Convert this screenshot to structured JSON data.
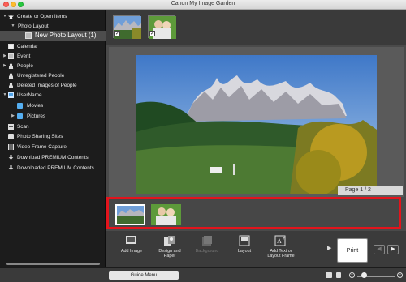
{
  "window": {
    "title": "Canon My Image Garden"
  },
  "sidebar": {
    "items": [
      {
        "label": "Create or Open Items",
        "icon": "star-icon"
      },
      {
        "label": "Photo Layout",
        "icon": ""
      },
      {
        "label": "New Photo Layout (1)",
        "icon": "layout-icon"
      },
      {
        "label": "Calendar",
        "icon": "calendar-icon"
      },
      {
        "label": "Event",
        "icon": "event-icon"
      },
      {
        "label": "People",
        "icon": "person-icon"
      },
      {
        "label": "Unregistered People",
        "icon": "person-icon"
      },
      {
        "label": "Deleted Images of People",
        "icon": "person-icon"
      },
      {
        "label": "UserName",
        "icon": "computer-icon"
      },
      {
        "label": "Movies",
        "icon": "folder-icon"
      },
      {
        "label": "Pictures",
        "icon": "folder-icon"
      },
      {
        "label": "Scan",
        "icon": "scan-icon"
      },
      {
        "label": "Photo Sharing Sites",
        "icon": "share-icon"
      },
      {
        "label": "Video Frame Capture",
        "icon": "film-icon"
      },
      {
        "label": "Download PREMIUM Contents",
        "icon": "download-icon"
      },
      {
        "label": "Downloaded PREMIUM Contents",
        "icon": "download-icon"
      }
    ]
  },
  "main": {
    "page_indicator": "Page 1 / 2",
    "toolbar": {
      "add_image": "Add Image",
      "design_and_paper": "Design and Paper",
      "background": "Background",
      "layout": "Layout",
      "add_text": "Add Text or Layout Frame",
      "print": "Print",
      "prev": "◀",
      "next": "▶",
      "more": "▶"
    }
  },
  "bottom": {
    "guide_menu": "Guide Menu"
  },
  "colors": {
    "highlight": "#e3141c",
    "selection": "#4d4d4d"
  }
}
